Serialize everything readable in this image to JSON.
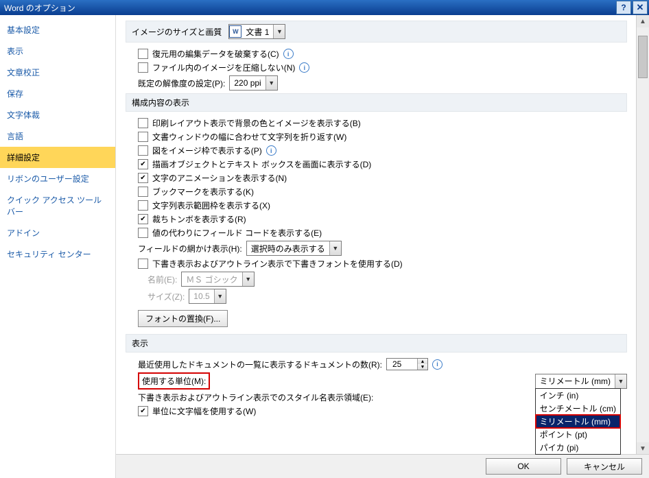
{
  "window": {
    "title": "Word のオプション"
  },
  "titlebar": {
    "help": "?",
    "close": "✕"
  },
  "sidebar": {
    "items": [
      "基本設定",
      "表示",
      "文章校正",
      "保存",
      "文字体裁",
      "言語",
      "詳細設定",
      "リボンのユーザー設定",
      "クイック アクセス ツール バー",
      "アドイン",
      "セキュリティ センター"
    ],
    "selected_index": 6
  },
  "sections": {
    "image": {
      "title": "イメージのサイズと画質",
      "doc_combo": "文書 1",
      "opts": {
        "discard_edit": "復元用の編集データを破棄する(C)",
        "no_compress": "ファイル内のイメージを圧縮しない(N)",
        "default_res_label": "既定の解像度の設定(P):",
        "default_res_value": "220 ppi"
      }
    },
    "doc_content": {
      "title": "構成内容の表示",
      "opts": {
        "print_bg": "印刷レイアウト表示で背景の色とイメージを表示する(B)",
        "wrap_window": "文書ウィンドウの幅に合わせて文字列を折り返す(W)",
        "pic_placeholder": "図をイメージ枠で表示する(P)",
        "show_drawings": "描画オブジェクトとテキスト ボックスを画面に表示する(D)",
        "text_anim": "文字のアニメーションを表示する(N)",
        "bookmarks": "ブックマークを表示する(K)",
        "text_boundaries": "文字列表示範囲枠を表示する(X)",
        "crop_marks": "裁ちトンボを表示する(R)",
        "field_codes": "値の代わりにフィールド コードを表示する(E)",
        "field_shading_label": "フィールドの網かけ表示(H):",
        "field_shading_value": "選択時のみ表示する",
        "draft_font": "下書き表示およびアウトライン表示で下書きフォントを使用する(D)",
        "font_name_label": "名前(E):",
        "font_name_value": "ＭＳ ゴシック",
        "font_size_label": "サイズ(Z):",
        "font_size_value": "10.5",
        "font_subst_btn": "フォントの置換(F)..."
      }
    },
    "display": {
      "title": "表示",
      "opts": {
        "recent_docs_label": "最近使用したドキュメントの一覧に表示するドキュメントの数(R):",
        "recent_docs_value": "25",
        "unit_label": "使用する単位(M):",
        "unit_value": "ミリメートル (mm)",
        "style_area_label": "下書き表示およびアウトライン表示でのスタイル名表示領域(E):",
        "char_width_unit": "単位に文字幅を使用する(W)"
      },
      "unit_options": [
        "インチ (in)",
        "センチメートル (cm)",
        "ミリメートル (mm)",
        "ポイント (pt)",
        "パイカ (pi)"
      ],
      "unit_selected_index": 2
    }
  },
  "footer": {
    "ok": "OK",
    "cancel": "キャンセル"
  }
}
